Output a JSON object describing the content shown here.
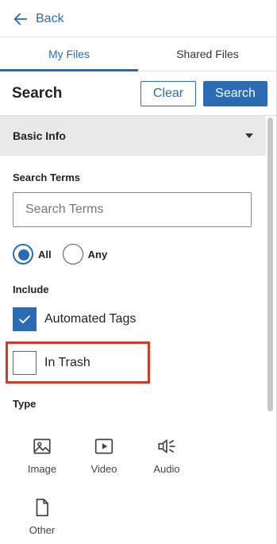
{
  "nav": {
    "back_label": "Back"
  },
  "tabs": [
    {
      "label": "My Files",
      "active": true
    },
    {
      "label": "Shared Files",
      "active": false
    }
  ],
  "search_header": {
    "title": "Search",
    "clear_label": "Clear",
    "search_label": "Search"
  },
  "section": {
    "title": "Basic Info",
    "expanded": true
  },
  "search_terms": {
    "label": "Search Terms",
    "placeholder": "Search Terms",
    "value": ""
  },
  "match_mode": {
    "options": [
      {
        "label": "All",
        "selected": true
      },
      {
        "label": "Any",
        "selected": false
      }
    ]
  },
  "include": {
    "label": "Include",
    "options": [
      {
        "label": "Automated Tags",
        "checked": true
      },
      {
        "label": "In Trash",
        "checked": false
      }
    ]
  },
  "type": {
    "label": "Type",
    "options": [
      {
        "label": "Image",
        "icon": "image-icon"
      },
      {
        "label": "Video",
        "icon": "video-icon"
      },
      {
        "label": "Audio",
        "icon": "audio-icon"
      },
      {
        "label": "Other",
        "icon": "file-icon"
      }
    ]
  },
  "colors": {
    "accent": "#2a6bb3",
    "highlight": "#d43a2a",
    "section_bg": "#e9e9e9"
  }
}
